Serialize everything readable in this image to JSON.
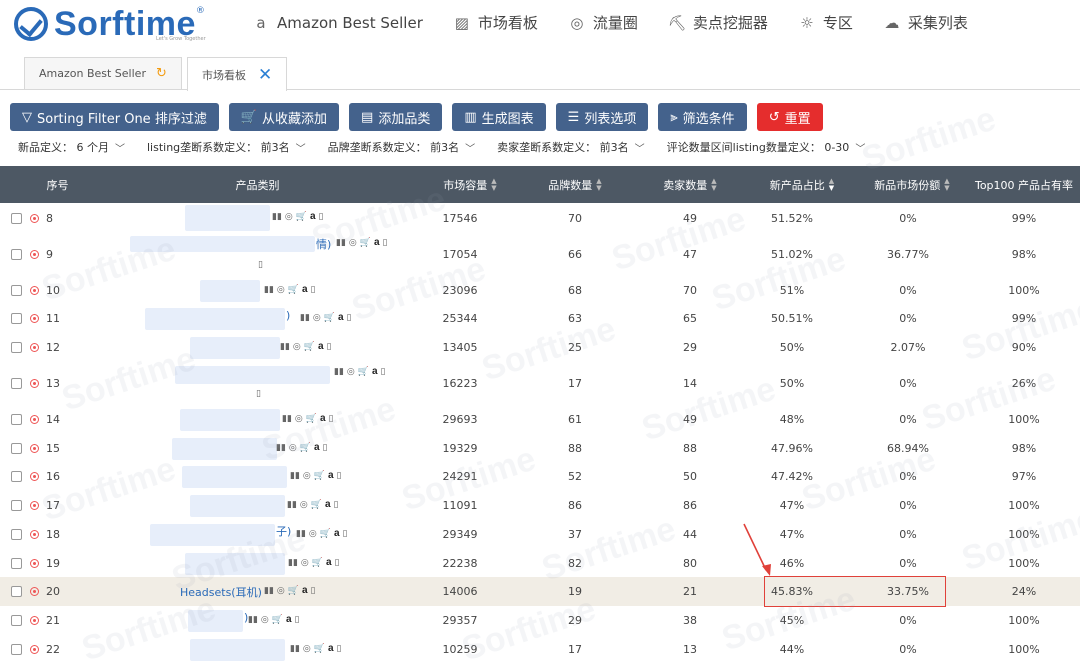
{
  "app": {
    "logo_text": "Sorftime",
    "logo_reg": "®",
    "logo_sub": "Let's Grow Together"
  },
  "nav": [
    {
      "label": "Amazon Best Seller",
      "icon": "amazon-icon"
    },
    {
      "label": "市场看板",
      "icon": "chart-icon"
    },
    {
      "label": "流量圈",
      "icon": "traffic-circle-icon"
    },
    {
      "label": "卖点挖掘器",
      "icon": "excavator-icon"
    },
    {
      "label": "专区",
      "icon": "bulb-icon"
    },
    {
      "label": "采集列表",
      "icon": "cloud-icon"
    }
  ],
  "tabs": [
    {
      "label": "Amazon Best Seller"
    },
    {
      "label": "市场看板"
    }
  ],
  "toolbar": [
    {
      "label": "Sorting Filter One 排序过滤",
      "icon": "filter-icon"
    },
    {
      "label": "从收藏添加",
      "icon": "cart-icon"
    },
    {
      "label": "添加品类",
      "icon": "document-icon"
    },
    {
      "label": "生成图表",
      "icon": "bar-chart-icon"
    },
    {
      "label": "列表选项",
      "icon": "list-icon"
    },
    {
      "label": "筛选条件",
      "icon": "funnel-icon"
    },
    {
      "label": "重置",
      "icon": "reset-icon"
    }
  ],
  "filters": [
    {
      "label": "新品定义：",
      "value": "6 个月"
    },
    {
      "label": "listing垄断系数定义：",
      "value": "前3名"
    },
    {
      "label": "品牌垄断系数定义：",
      "value": "前3名"
    },
    {
      "label": "卖家垄断系数定义：",
      "value": "前3名"
    },
    {
      "label": "评论数量区间listing数量定义：",
      "value": "0-30"
    }
  ],
  "columns": [
    "序号",
    "产品类别",
    "市场容量",
    "品牌数量",
    "卖家数量",
    "新产品占比",
    "新品市场份额",
    "Top100 产品占有率"
  ],
  "rows": [
    {
      "no": "8",
      "cat": "",
      "cat_suffix": "",
      "cap": "17546",
      "brands": "70",
      "sellers": "49",
      "new_ratio": "51.52%",
      "new_share": "0%",
      "top100": "99%"
    },
    {
      "no": "9",
      "cat": "",
      "cat_suffix": "情)",
      "cap": "17054",
      "brands": "66",
      "sellers": "47",
      "new_ratio": "51.02%",
      "new_share": "36.77%",
      "top100": "98%"
    },
    {
      "no": "10",
      "cat": "",
      "cat_suffix": "",
      "cap": "23096",
      "brands": "68",
      "sellers": "70",
      "new_ratio": "51%",
      "new_share": "0%",
      "top100": "100%"
    },
    {
      "no": "11",
      "cat": "",
      "cat_suffix": ")",
      "cap": "25344",
      "brands": "63",
      "sellers": "65",
      "new_ratio": "50.51%",
      "new_share": "0%",
      "top100": "99%"
    },
    {
      "no": "12",
      "cat": "",
      "cat_suffix": "",
      "cap": "13405",
      "brands": "25",
      "sellers": "29",
      "new_ratio": "50%",
      "new_share": "2.07%",
      "top100": "90%"
    },
    {
      "no": "13",
      "cat": "",
      "cat_suffix": "",
      "cap": "16223",
      "brands": "17",
      "sellers": "14",
      "new_ratio": "50%",
      "new_share": "0%",
      "top100": "26%"
    },
    {
      "no": "14",
      "cat": "",
      "cat_suffix": "",
      "cap": "29693",
      "brands": "61",
      "sellers": "49",
      "new_ratio": "48%",
      "new_share": "0%",
      "top100": "100%"
    },
    {
      "no": "15",
      "cat": "",
      "cat_suffix": "",
      "cap": "19329",
      "brands": "88",
      "sellers": "88",
      "new_ratio": "47.96%",
      "new_share": "68.94%",
      "top100": "98%"
    },
    {
      "no": "16",
      "cat": "",
      "cat_suffix": "",
      "cap": "24291",
      "brands": "52",
      "sellers": "50",
      "new_ratio": "47.42%",
      "new_share": "0%",
      "top100": "97%"
    },
    {
      "no": "17",
      "cat": "",
      "cat_suffix": "",
      "cap": "11091",
      "brands": "86",
      "sellers": "86",
      "new_ratio": "47%",
      "new_share": "0%",
      "top100": "100%"
    },
    {
      "no": "18",
      "cat": "",
      "cat_suffix": "子)",
      "cap": "29349",
      "brands": "37",
      "sellers": "44",
      "new_ratio": "47%",
      "new_share": "0%",
      "top100": "100%"
    },
    {
      "no": "19",
      "cat": "",
      "cat_suffix": "",
      "cap": "22238",
      "brands": "82",
      "sellers": "80",
      "new_ratio": "46%",
      "new_share": "0%",
      "top100": "100%"
    },
    {
      "no": "20",
      "cat": "Headsets(耳机)",
      "cat_suffix": "",
      "cap": "14006",
      "brands": "19",
      "sellers": "21",
      "new_ratio": "45.83%",
      "new_share": "33.75%",
      "top100": "24%"
    },
    {
      "no": "21",
      "cat": "",
      "cat_suffix": ")",
      "cap": "29357",
      "brands": "29",
      "sellers": "38",
      "new_ratio": "45%",
      "new_share": "0%",
      "top100": "100%"
    },
    {
      "no": "22",
      "cat": "",
      "cat_suffix": "",
      "cap": "10259",
      "brands": "17",
      "sellers": "13",
      "new_ratio": "44%",
      "new_share": "0%",
      "top100": "100%"
    }
  ],
  "watermark": "Sorftime",
  "colors": {
    "brand": "#2a6ab8",
    "header_bg": "#4d5864",
    "button_bg": "#44628c",
    "reset_bg": "#e52d2d",
    "highlight_row": "#f1ede5",
    "annotation": "#e0413a"
  }
}
